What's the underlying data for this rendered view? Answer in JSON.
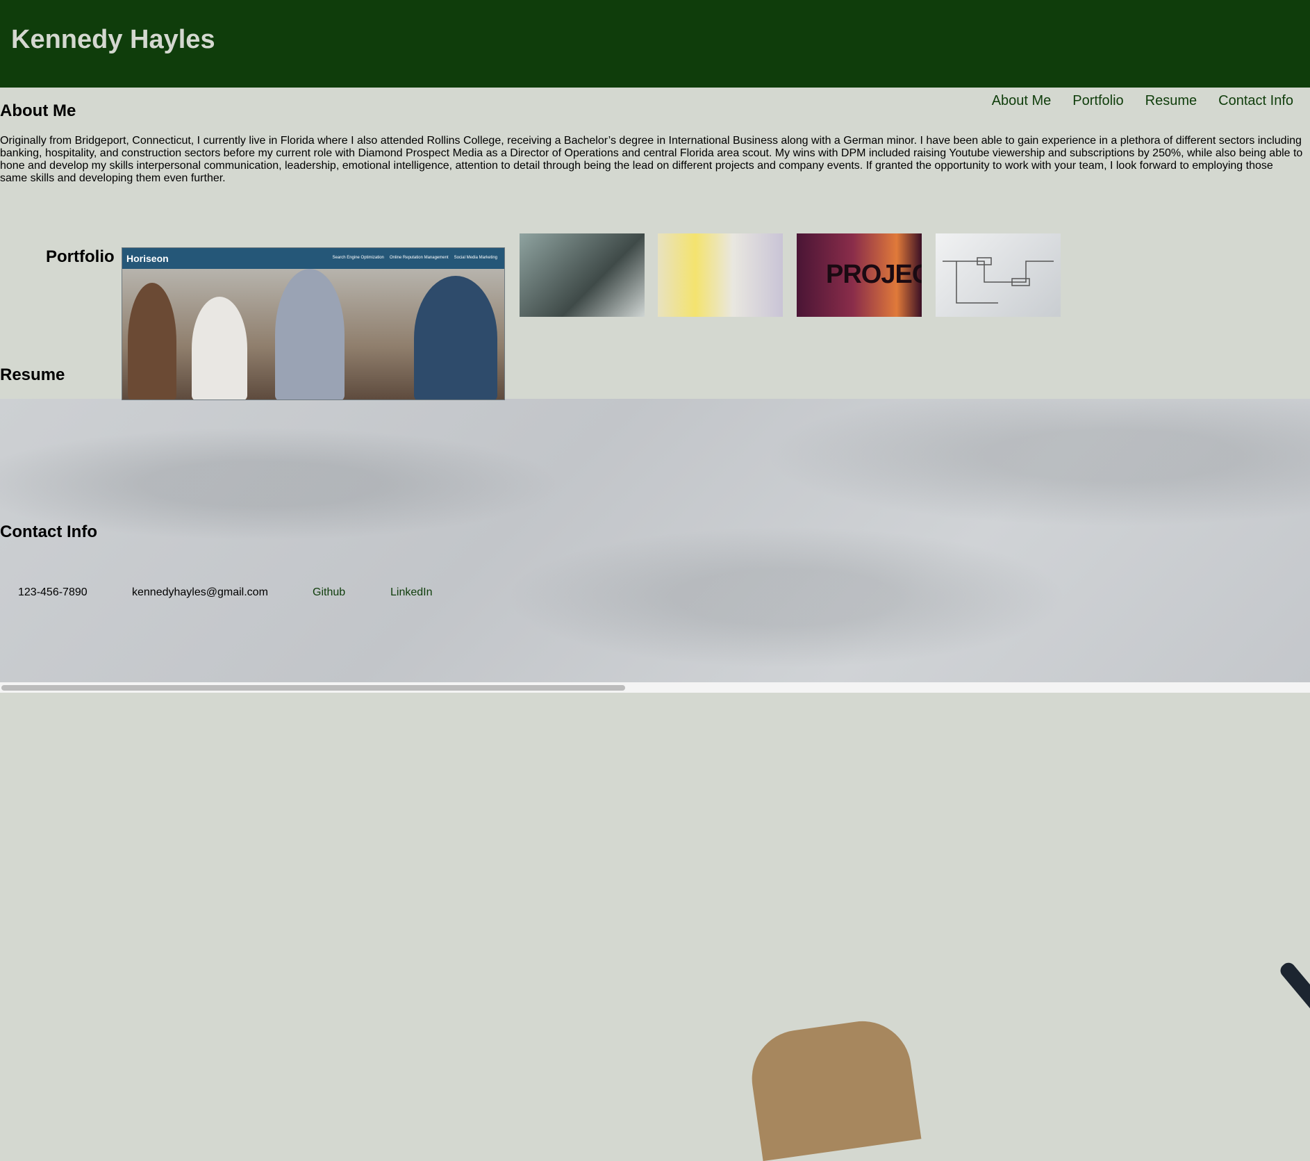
{
  "header": {
    "title": "Kennedy Hayles",
    "background": "#0f3d0b"
  },
  "nav": {
    "items": [
      "About Me",
      "Portfolio",
      "Resume",
      "Contact Info"
    ],
    "color": "#0f3d0b"
  },
  "about": {
    "heading": "About Me",
    "text": "Originally from Bridgeport, Connecticut, I currently live in Florida where I also attended Rollins College, receiving a Bachelor’s degree in International Business along with a German minor. I have been able to gain experience in a plethora of different sectors including banking, hospitality, and construction sectors before my current role with Diamond Prospect Media as a Director of Operations and central Florida area scout. My wins with DPM included raising Youtube viewership and subscriptions by 250%, while also being able to hone and develop my skills interpersonal communication, leadership, emotional intelligence, attention to detail through being the lead on different projects and company events. If granted the opportunity to work with your team, I look forward to employing those same skills and developing them even further."
  },
  "portfolio": {
    "heading": "Portfolio",
    "featured": {
      "logo": "Horiseon",
      "links": [
        "Search Engine Optimization",
        "Online Reputation Management",
        "Social Media Marketing"
      ]
    },
    "thumbnails": [
      {
        "icon": "laptop-desk-photo"
      },
      {
        "icon": "sticky-notes-board-photo"
      },
      {
        "icon": "projects-sign-photo",
        "text": "PROJECTS"
      },
      {
        "icon": "wireframe-sketch-photo"
      }
    ]
  },
  "resume": {
    "heading": "Resume"
  },
  "contact": {
    "heading": "Contact Info",
    "phone": "123-456-7890",
    "email": "kennedyhayles@gmail.com",
    "github": "Github",
    "linkedin": "LinkedIn"
  },
  "colors": {
    "page_bg": "#d4d8d0",
    "accent": "#0f3d0b",
    "featured_bar": "#255778"
  }
}
